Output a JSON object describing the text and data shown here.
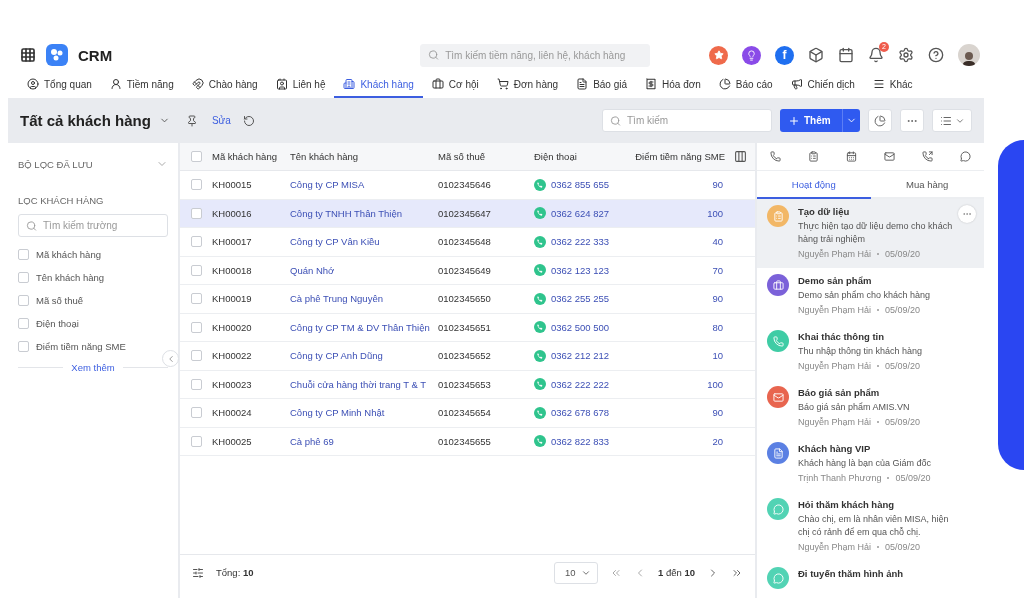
{
  "header": {
    "app_name": "CRM",
    "search_placeholder": "Tìm kiếm tiềm năng, liên hệ, khách hàng",
    "social_letter": "f",
    "notification_count": "2"
  },
  "nav_tabs": [
    {
      "label": "Tổng quan",
      "selected": false
    },
    {
      "label": "Tiềm năng",
      "selected": false
    },
    {
      "label": "Chào hàng",
      "selected": false
    },
    {
      "label": "Liên hệ",
      "selected": false
    },
    {
      "label": "Khách hàng",
      "selected": true
    },
    {
      "label": "Cơ hội",
      "selected": false
    },
    {
      "label": "Đơn hàng",
      "selected": false
    },
    {
      "label": "Báo giá",
      "selected": false
    },
    {
      "label": "Hóa đơn",
      "selected": false
    },
    {
      "label": "Báo cáo",
      "selected": false
    },
    {
      "label": "Chiến dịch",
      "selected": false
    },
    {
      "label": "Khác",
      "selected": false
    }
  ],
  "toolbar": {
    "title": "Tất cả khách hàng",
    "edit_link": "Sửa",
    "search_placeholder": "Tìm kiếm",
    "add_button": "Thêm"
  },
  "filter_panel": {
    "saved_filters": "BỘ LỌC ĐÃ LƯU",
    "filter_heading": "LỌC KHÁCH HÀNG",
    "search_placeholder": "Tìm kiếm trường",
    "fields": [
      {
        "label": "Mã khách hàng",
        "checked": false
      },
      {
        "label": "Tên khách hàng",
        "checked": false
      },
      {
        "label": "Mã số thuế",
        "checked": false
      },
      {
        "label": "Điện thoại",
        "checked": false
      },
      {
        "label": "Điểm tiềm năng SME",
        "checked": false
      }
    ],
    "more_link": "Xem thêm"
  },
  "table": {
    "all_checked": false,
    "columns": [
      "Mã khách hàng",
      "Tên khách hàng",
      "Mã số thuế",
      "Điện thoại",
      "Điểm tiềm năng SME"
    ],
    "rows": [
      {
        "code": "KH00015",
        "name": "Công ty CP MISA",
        "tax": "0102345646",
        "phone": "0362 855 655",
        "score": "90",
        "selected": false,
        "checked": false
      },
      {
        "code": "KH00016",
        "name": "Công ty TNHH Thân Thiện",
        "tax": "0102345647",
        "phone": "0362 624 827",
        "score": "100",
        "selected": true,
        "checked": false
      },
      {
        "code": "KH00017",
        "name": "Công ty CP Vân Kiều",
        "tax": "0102345648",
        "phone": "0362 222 333",
        "score": "40",
        "selected": false,
        "checked": false
      },
      {
        "code": "KH00018",
        "name": "Quán Nhớ",
        "tax": "0102345649",
        "phone": "0362 123 123",
        "score": "70",
        "selected": false,
        "checked": false
      },
      {
        "code": "KH00019",
        "name": "Cà phê Trung Nguyên",
        "tax": "0102345650",
        "phone": "0362 255 255",
        "score": "90",
        "selected": false,
        "checked": false
      },
      {
        "code": "KH00020",
        "name": "Công ty CP TM & DV Thân Thiện",
        "tax": "0102345651",
        "phone": "0362 500 500",
        "score": "80",
        "selected": false,
        "checked": false
      },
      {
        "code": "KH00022",
        "name": "Công ty CP Anh Dũng",
        "tax": "0102345652",
        "phone": "0362 212 212",
        "score": "10",
        "selected": false,
        "checked": false
      },
      {
        "code": "KH00023",
        "name": "Chuỗi cửa hàng thời trang T & T",
        "tax": "0102345653",
        "phone": "0362 222 222",
        "score": "100",
        "selected": false,
        "checked": false
      },
      {
        "code": "KH00024",
        "name": "Công ty CP Minh Nhật",
        "tax": "0102345654",
        "phone": "0362 678 678",
        "score": "90",
        "selected": false,
        "checked": false
      },
      {
        "code": "KH00025",
        "name": "Cà phê 69",
        "tax": "0102345655",
        "phone": "0362 822 833",
        "score": "20",
        "selected": false,
        "checked": false
      }
    ],
    "footer": {
      "total": "Tổng: **10**",
      "page_size": "10",
      "range": "**1** đến **10**"
    }
  },
  "activity_panel": {
    "tabs": [
      {
        "label": "Hoạt động",
        "selected": true
      },
      {
        "label": "Mua hàng",
        "selected": false
      }
    ],
    "activities": [
      {
        "kind": "task",
        "color": "#f2b766",
        "title": "Tạo dữ liệu",
        "description": "Thực hiện tạo dữ liệu demo cho khách hàng trải nghiệm",
        "author": "Nguyễn Phạm Hải",
        "date": "05/09/20",
        "selected": true
      },
      {
        "kind": "meeting",
        "color": "#7b61d9",
        "title": "Demo sản phẩm",
        "description": "Demo sản phẩm cho khách hàng",
        "author": "Nguyễn Phạm Hải",
        "date": "05/09/20",
        "selected": false
      },
      {
        "kind": "call",
        "color": "#3fcca5",
        "title": "Khai thác thông tin",
        "description": "Thu nhập thông tin khách hàng",
        "author": "Nguyễn Phạm Hải",
        "date": "05/09/20",
        "selected": false
      },
      {
        "kind": "email",
        "color": "#e8654f",
        "title": "Báo giá sản phẩm",
        "description": "Báo giá sản phẩm AMIS.VN",
        "author": "Nguyễn Phạm Hải",
        "date": "05/09/20",
        "selected": false
      },
      {
        "kind": "note",
        "color": "#5b80e3",
        "title": "Khách hàng VIP",
        "description": "Khách hàng là bạn của Giám đốc",
        "author": "Trịnh Thanh Phương",
        "date": "05/09/20",
        "selected": false
      },
      {
        "kind": "chat",
        "color": "#52d3b4",
        "title": "Hỏi thăm khách hàng",
        "description": "Chào chị, em là nhân viên MISA, hiện chị có rảnh để em qua chỗ chị.",
        "author": "Nguyễn Phạm Hải",
        "date": "05/09/20",
        "selected": false
      },
      {
        "kind": "chat",
        "color": "#52d3b4",
        "title": "Đi tuyến thăm hình ảnh",
        "selected": false
      }
    ]
  }
}
